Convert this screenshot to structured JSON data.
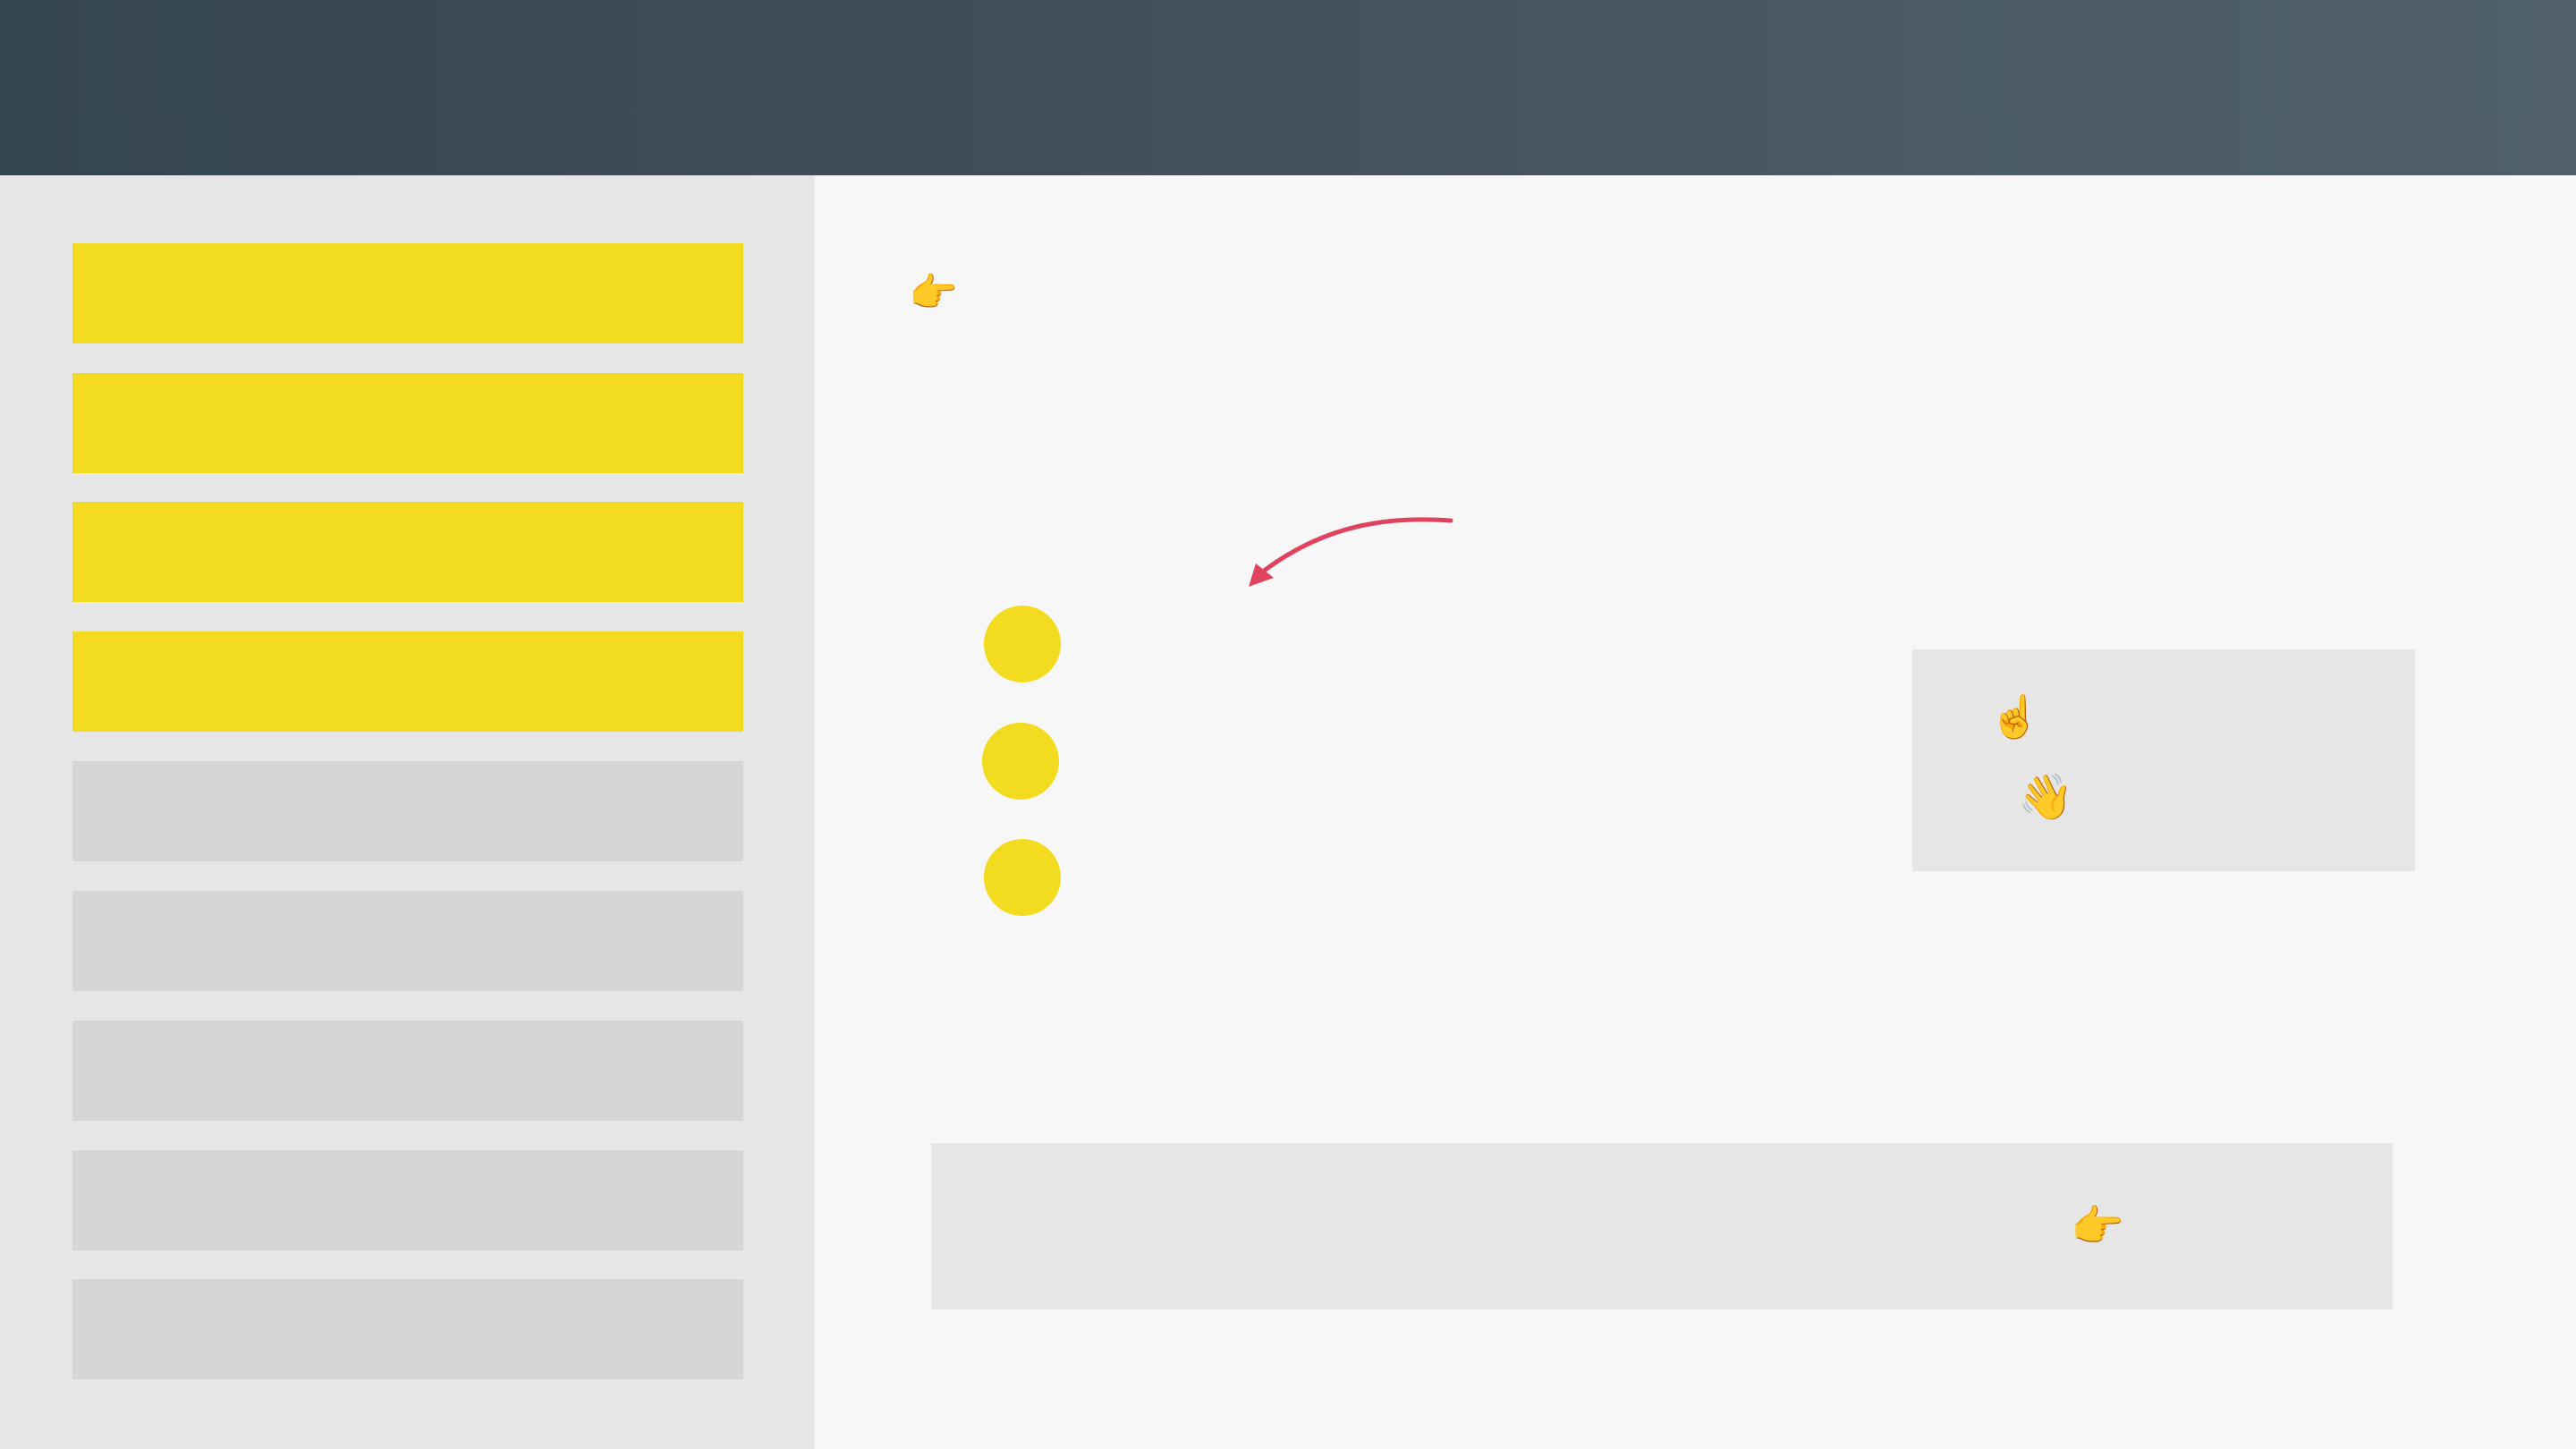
{
  "app": {
    "window_title": ""
  },
  "theme": {
    "header_gradient_start": "#344650",
    "header_gradient_end": "#4f6068",
    "accent_yellow": "#f3dc1f",
    "sidebar_bg": "#e6e6e6",
    "nav_item_inactive": "#d6d6d6",
    "main_bg": "#f7f7f7",
    "arrow_color": "#e0435e"
  },
  "sidebar": {
    "items": [
      {
        "label": "",
        "active": true
      },
      {
        "label": "",
        "active": true
      },
      {
        "label": "",
        "active": true
      },
      {
        "label": "",
        "active": true
      },
      {
        "label": "",
        "active": false
      },
      {
        "label": "",
        "active": false
      },
      {
        "label": "",
        "active": false
      },
      {
        "label": "",
        "active": false
      },
      {
        "label": "",
        "active": false
      }
    ]
  },
  "main": {
    "pointer_top": {
      "icon": "pointing-right-hand-icon",
      "glyph": "👉"
    },
    "annotation_arrow": {
      "icon": "curved-arrow-icon"
    },
    "dots": [
      {
        "icon": "yellow-dot"
      },
      {
        "icon": "yellow-dot"
      },
      {
        "icon": "yellow-dot"
      }
    ],
    "side_panel": {
      "icons": [
        {
          "icon": "index-pointing-up-icon",
          "glyph": "☝️"
        },
        {
          "icon": "waving-hand-icon",
          "glyph": "👋"
        }
      ]
    },
    "bottom_panel": {
      "icon": {
        "icon": "pointing-right-hand-icon",
        "glyph": "👉"
      }
    }
  }
}
